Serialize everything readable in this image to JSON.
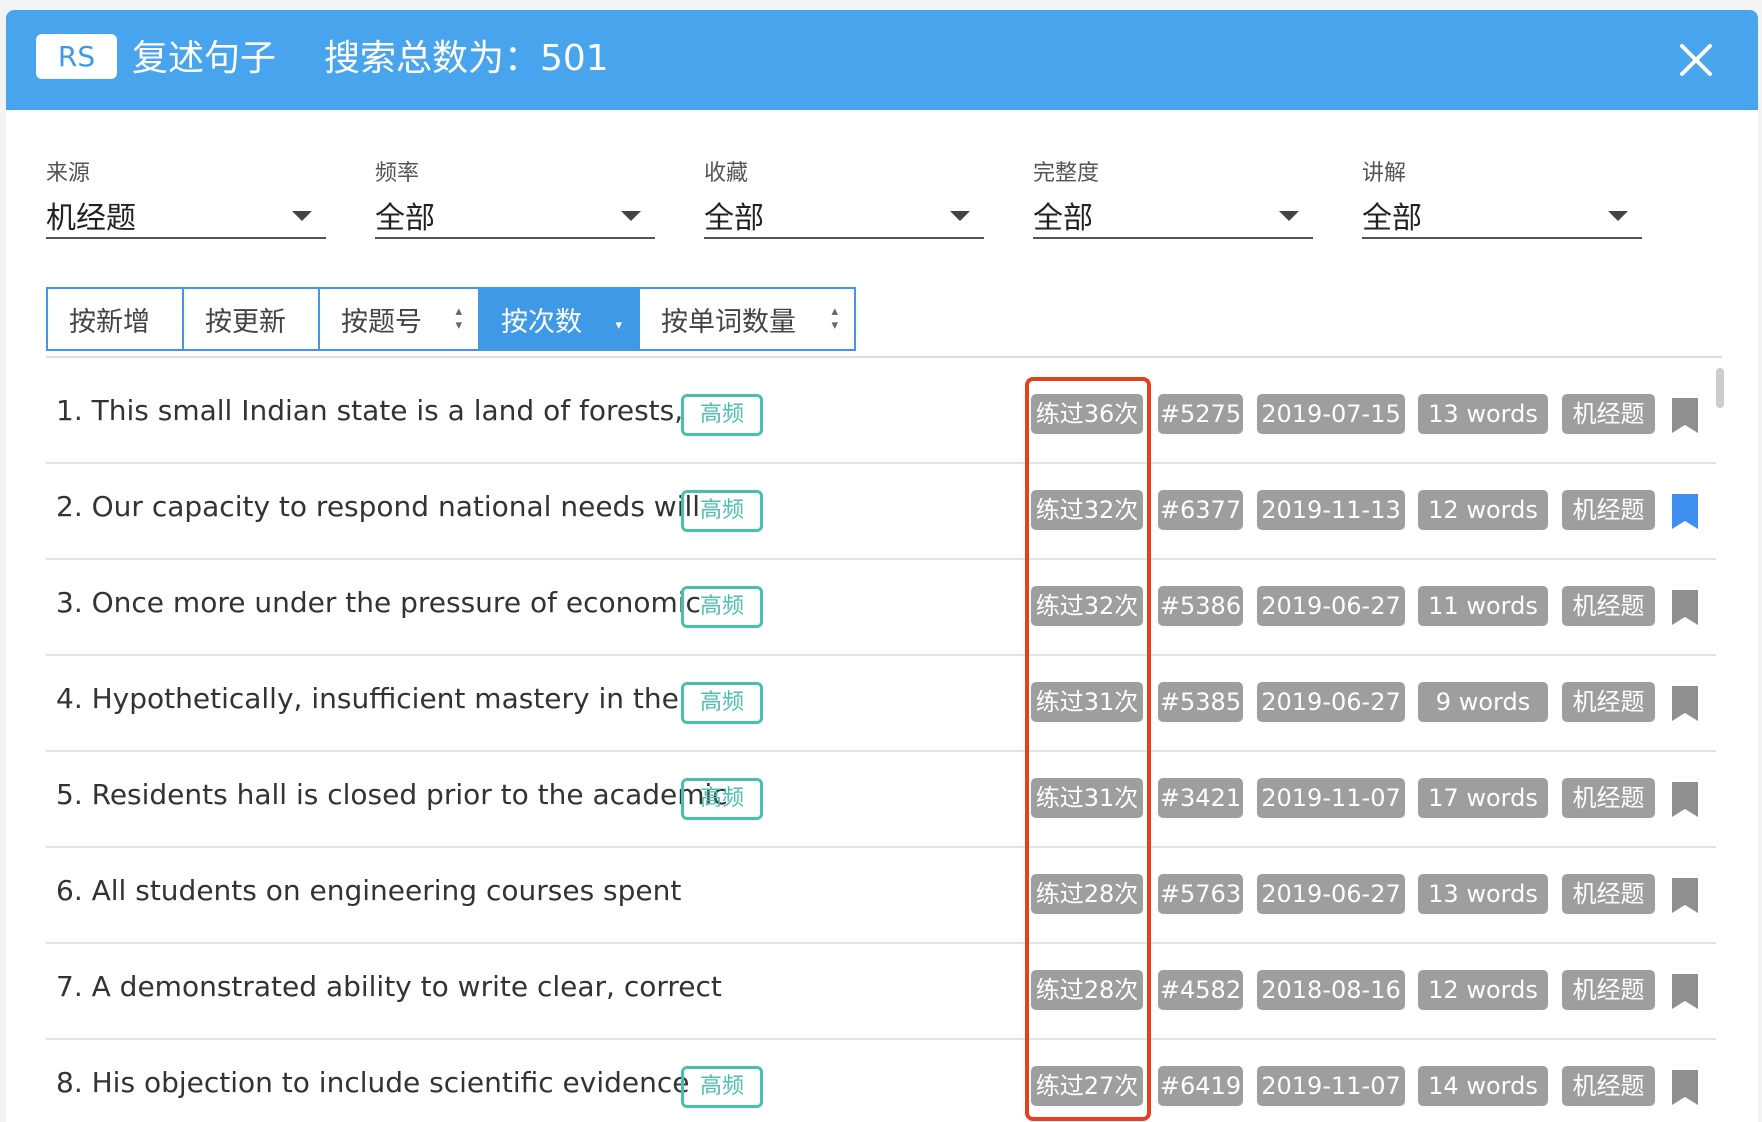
{
  "header": {
    "badge": "RS",
    "title": "复述句子",
    "count_text": "搜索总数为：501"
  },
  "filters": [
    {
      "label": "来源",
      "value": "机经题"
    },
    {
      "label": "频率",
      "value": "全部"
    },
    {
      "label": "收藏",
      "value": "全部"
    },
    {
      "label": "完整度",
      "value": "全部"
    },
    {
      "label": "讲解",
      "value": "全部"
    }
  ],
  "sort": {
    "options": [
      "按新增",
      "按更新",
      "按题号",
      "按次数",
      "按单词数量"
    ],
    "active": "按次数"
  },
  "hot_label": "高频",
  "items": [
    {
      "text": "1. This small Indian state is a land of forests,",
      "hot": true,
      "practice": "练过36次",
      "num": "#5275",
      "date": "2019-07-15",
      "words": "13 words",
      "source": "机经题",
      "bookmarked": false
    },
    {
      "text": "2. Our capacity to respond national needs will",
      "hot": true,
      "practice": "练过32次",
      "num": "#6377",
      "date": "2019-11-13",
      "words": "12 words",
      "source": "机经题",
      "bookmarked": true
    },
    {
      "text": "3. Once more under the pressure of economic",
      "hot": true,
      "practice": "练过32次",
      "num": "#5386",
      "date": "2019-06-27",
      "words": "11 words",
      "source": "机经题",
      "bookmarked": false
    },
    {
      "text": "4. Hypothetically, insufficient mastery in the",
      "hot": true,
      "practice": "练过31次",
      "num": "#5385",
      "date": "2019-06-27",
      "words": "9 words",
      "source": "机经题",
      "bookmarked": false
    },
    {
      "text": "5. Residents hall is closed prior to the academic",
      "hot": true,
      "practice": "练过31次",
      "num": "#3421",
      "date": "2019-11-07",
      "words": "17 words",
      "source": "机经题",
      "bookmarked": false
    },
    {
      "text": "6. All students on engineering courses spent",
      "hot": false,
      "practice": "练过28次",
      "num": "#5763",
      "date": "2019-06-27",
      "words": "13 words",
      "source": "机经题",
      "bookmarked": false
    },
    {
      "text": "7. A demonstrated ability to write clear, correct",
      "hot": false,
      "practice": "练过28次",
      "num": "#4582",
      "date": "2018-08-16",
      "words": "12 words",
      "source": "机经题",
      "bookmarked": false
    },
    {
      "text": "8. His objection to include scientific evidence",
      "hot": true,
      "practice": "练过27次",
      "num": "#6419",
      "date": "2019-11-07",
      "words": "14 words",
      "source": "机经题",
      "bookmarked": false
    }
  ],
  "colors": {
    "header_bg": "#48a4ec",
    "accent": "#3f99e6",
    "hot": "#4bbfae",
    "tag_bg": "#9e9e9e",
    "highlight": "#e6401f",
    "bookmark_off": "#8f8f8f",
    "bookmark_on": "#3f8ff0"
  }
}
